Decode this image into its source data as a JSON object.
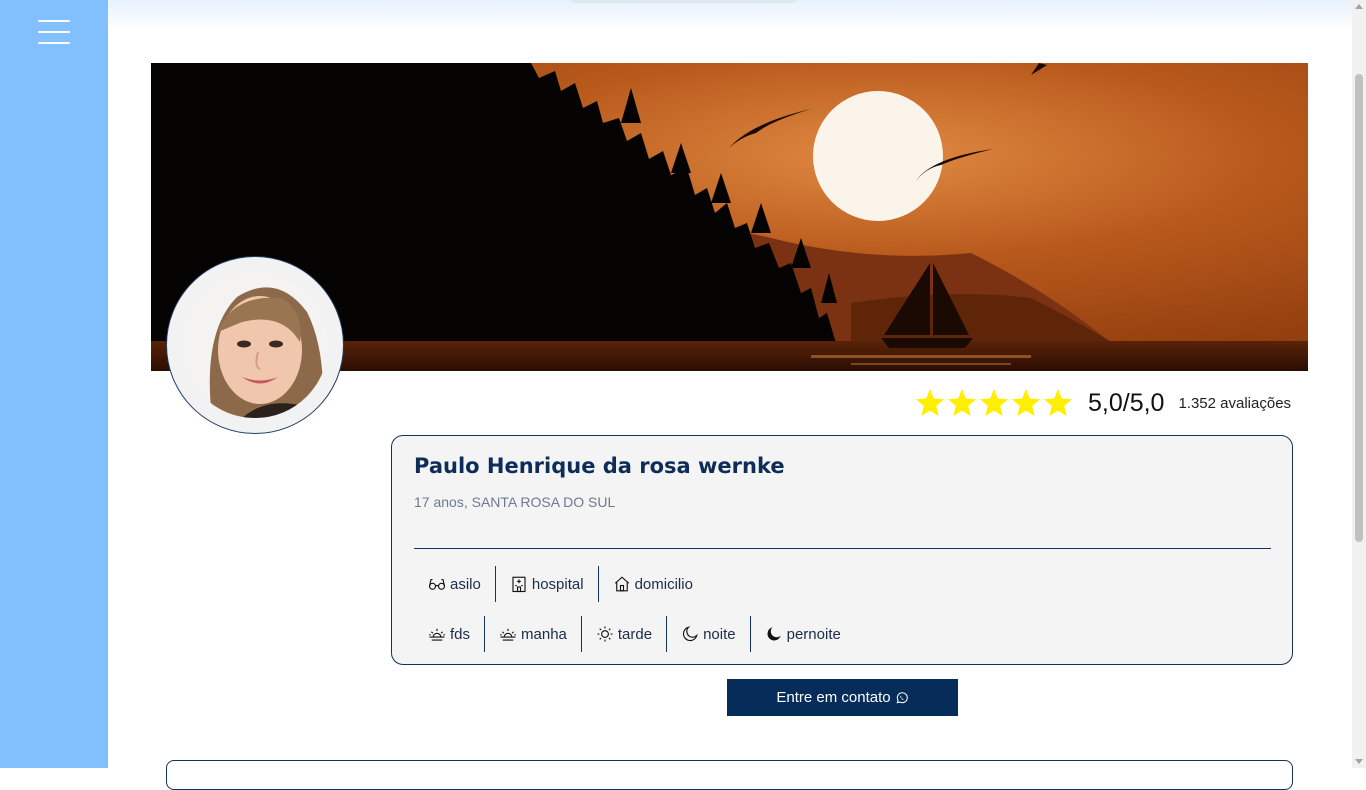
{
  "profile": {
    "name": "Paulo Henrique da rosa wernke",
    "details": "17 anos, SANTA ROSA DO SUL"
  },
  "rating": {
    "stars": 5,
    "score": "5,0/5,0",
    "count": "1.352 avaliações"
  },
  "places": [
    {
      "label": "asilo",
      "icon": "glasses-icon"
    },
    {
      "label": "hospital",
      "icon": "hospital-icon"
    },
    {
      "label": "domicilio",
      "icon": "house-icon"
    }
  ],
  "shifts": [
    {
      "label": "fds",
      "icon": "sunrise-icon"
    },
    {
      "label": "manha",
      "icon": "sunrise-icon"
    },
    {
      "label": "tarde",
      "icon": "sun-icon"
    },
    {
      "label": "noite",
      "icon": "moon-outline-icon"
    },
    {
      "label": "pernoite",
      "icon": "moon-filled-icon"
    }
  ],
  "contact_button": {
    "label": "Entre em contato",
    "icon": "whatsapp-icon"
  },
  "colors": {
    "sidebar": "#82c0fd",
    "navy": "#062c5a",
    "star": "#ffee00"
  }
}
